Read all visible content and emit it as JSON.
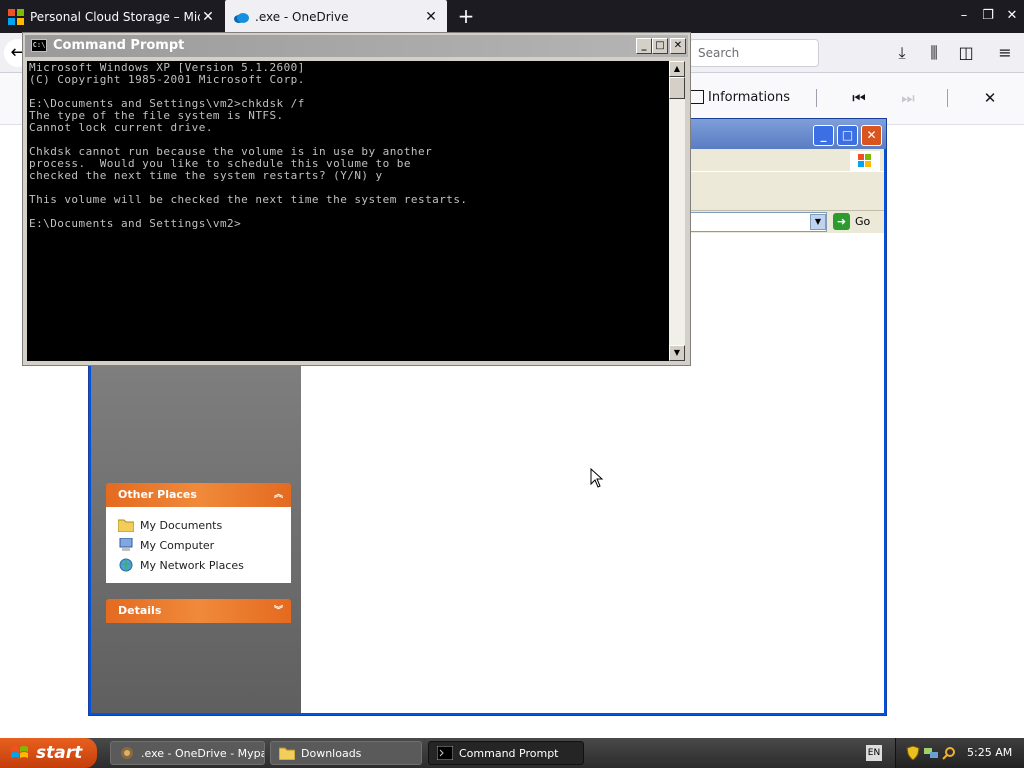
{
  "browser": {
    "tabs": [
      {
        "title": "Personal Cloud Storage – Microsof",
        "active": false
      },
      {
        "title": ".exe - OneDrive",
        "active": true
      }
    ],
    "search_placeholder": "Search",
    "infobar_label": "Informations"
  },
  "explorer": {
    "go_label": "Go",
    "other_places": {
      "header": "Other Places",
      "items": [
        "My Documents",
        "My Computer",
        "My Network Places"
      ]
    },
    "details": {
      "header": "Details"
    }
  },
  "cmd": {
    "title": "Command Prompt",
    "lines": [
      "Microsoft Windows XP [Version 5.1.2600]",
      "(C) Copyright 1985-2001 Microsoft Corp.",
      "",
      "E:\\Documents and Settings\\vm2>chkdsk /f",
      "The type of the file system is NTFS.",
      "Cannot lock current drive.",
      "",
      "Chkdsk cannot run because the volume is in use by another",
      "process.  Would you like to schedule this volume to be",
      "checked the next time the system restarts? (Y/N) y",
      "",
      "This volume will be checked the next time the system restarts.",
      "",
      "E:\\Documents and Settings\\vm2>"
    ]
  },
  "taskbar": {
    "start_label": "start",
    "tasks": [
      ".exe - OneDrive - Mypal",
      "Downloads",
      "Command Prompt"
    ],
    "language": "EN",
    "clock": "5:25 AM"
  },
  "colors": {
    "accent_orange": "#e46a20",
    "xp_blue": "#0054e3",
    "cmd_text": "#c0c0c0"
  }
}
